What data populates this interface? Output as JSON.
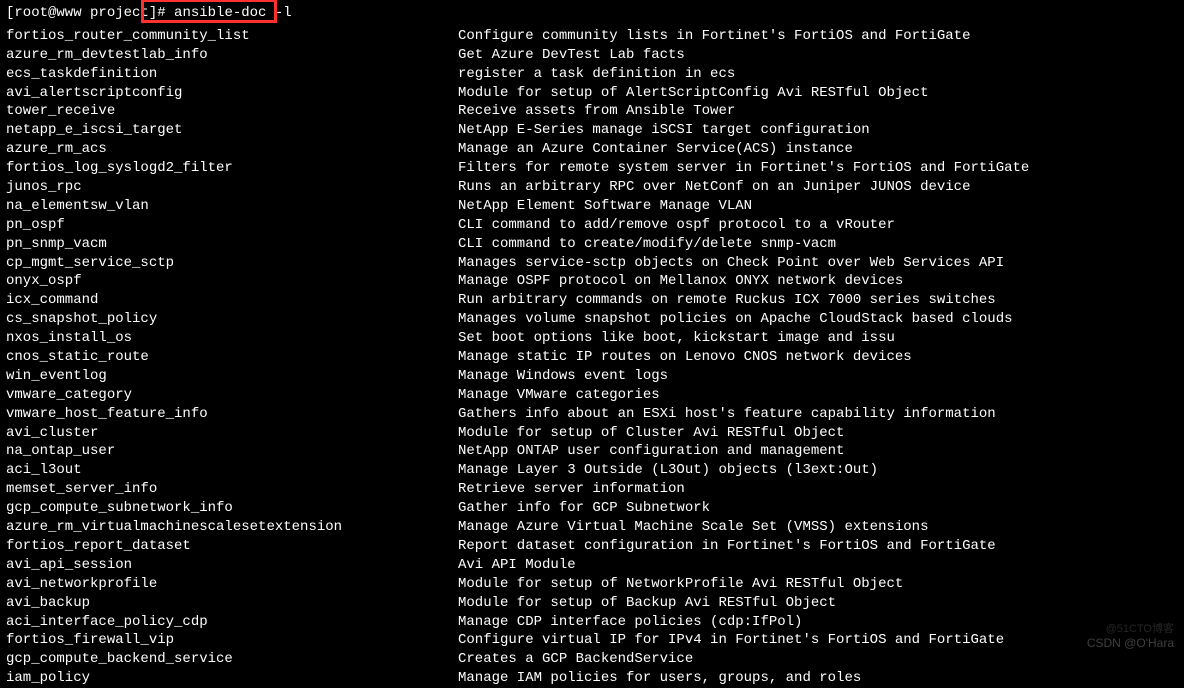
{
  "prompt": {
    "user_host": "[root@www project]",
    "hash": "#",
    "command": "ansible-doc -l"
  },
  "modules": [
    {
      "name": "fortios_router_community_list",
      "desc": "Configure community lists in Fortinet's FortiOS and FortiGate"
    },
    {
      "name": "azure_rm_devtestlab_info",
      "desc": "Get Azure DevTest Lab facts"
    },
    {
      "name": "ecs_taskdefinition",
      "desc": "register a task definition in ecs"
    },
    {
      "name": "avi_alertscriptconfig",
      "desc": "Module for setup of AlertScriptConfig Avi RESTful Object"
    },
    {
      "name": "tower_receive",
      "desc": "Receive assets from Ansible Tower"
    },
    {
      "name": "netapp_e_iscsi_target",
      "desc": "NetApp E-Series manage iSCSI target configuration"
    },
    {
      "name": "azure_rm_acs",
      "desc": "Manage an Azure Container Service(ACS) instance"
    },
    {
      "name": "fortios_log_syslogd2_filter",
      "desc": "Filters for remote system server in Fortinet's FortiOS and FortiGate"
    },
    {
      "name": "junos_rpc",
      "desc": "Runs an arbitrary RPC over NetConf on an Juniper JUNOS device"
    },
    {
      "name": "na_elementsw_vlan",
      "desc": "NetApp Element Software Manage VLAN"
    },
    {
      "name": "pn_ospf",
      "desc": "CLI command to add/remove ospf protocol to a vRouter"
    },
    {
      "name": "pn_snmp_vacm",
      "desc": "CLI command to create/modify/delete snmp-vacm"
    },
    {
      "name": "cp_mgmt_service_sctp",
      "desc": "Manages service-sctp objects on Check Point over Web Services API"
    },
    {
      "name": "onyx_ospf",
      "desc": "Manage OSPF protocol on Mellanox ONYX network devices"
    },
    {
      "name": "icx_command",
      "desc": "Run arbitrary commands on remote Ruckus ICX 7000 series switches"
    },
    {
      "name": "cs_snapshot_policy",
      "desc": "Manages volume snapshot policies on Apache CloudStack based clouds"
    },
    {
      "name": "nxos_install_os",
      "desc": "Set boot options like boot, kickstart image and issu"
    },
    {
      "name": "cnos_static_route",
      "desc": "Manage static IP routes on Lenovo CNOS network devices"
    },
    {
      "name": "win_eventlog",
      "desc": "Manage Windows event logs"
    },
    {
      "name": "vmware_category",
      "desc": "Manage VMware categories"
    },
    {
      "name": "vmware_host_feature_info",
      "desc": "Gathers info about an ESXi host's feature capability information"
    },
    {
      "name": "avi_cluster",
      "desc": "Module for setup of Cluster Avi RESTful Object"
    },
    {
      "name": "na_ontap_user",
      "desc": "NetApp ONTAP user configuration and management"
    },
    {
      "name": "aci_l3out",
      "desc": "Manage Layer 3 Outside (L3Out) objects (l3ext:Out)"
    },
    {
      "name": "memset_server_info",
      "desc": "Retrieve server information"
    },
    {
      "name": "gcp_compute_subnetwork_info",
      "desc": "Gather info for GCP Subnetwork"
    },
    {
      "name": "azure_rm_virtualmachinescalesetextension",
      "desc": "Manage Azure Virtual Machine Scale Set (VMSS) extensions"
    },
    {
      "name": "fortios_report_dataset",
      "desc": "Report dataset configuration in Fortinet's FortiOS and FortiGate"
    },
    {
      "name": "avi_api_session",
      "desc": "Avi API Module"
    },
    {
      "name": "avi_networkprofile",
      "desc": "Module for setup of NetworkProfile Avi RESTful Object"
    },
    {
      "name": "avi_backup",
      "desc": "Module for setup of Backup Avi RESTful Object"
    },
    {
      "name": "aci_interface_policy_cdp",
      "desc": "Manage CDP interface policies (cdp:IfPol)"
    },
    {
      "name": "fortios_firewall_vip",
      "desc": "Configure virtual IP for IPv4 in Fortinet's FortiOS and FortiGate"
    },
    {
      "name": "gcp_compute_backend_service",
      "desc": "Creates a GCP BackendService"
    },
    {
      "name": "iam_policy",
      "desc": "Manage IAM policies for users, groups, and roles"
    }
  ],
  "watermark": {
    "top": "@51CTO博客",
    "bottom": "CSDN @O'Hara"
  }
}
